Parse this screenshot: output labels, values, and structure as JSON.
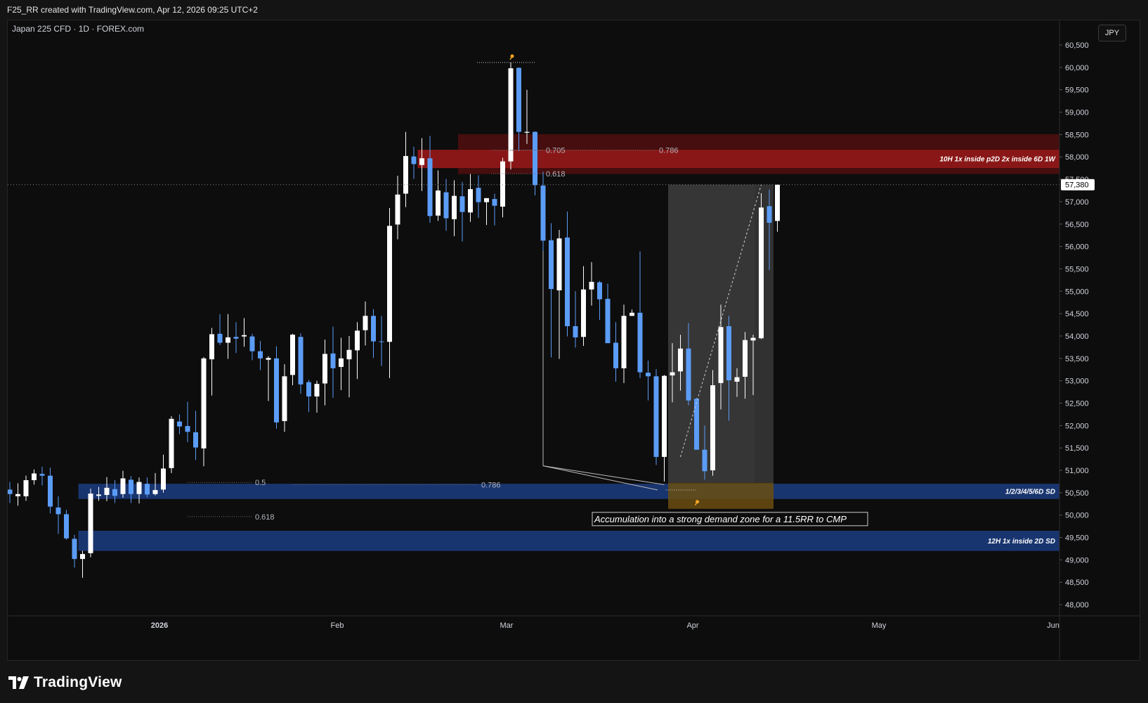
{
  "header": {
    "caption": "F25_RR created with TradingView.com, Apr 12, 2026 09:25 UTC+2"
  },
  "symbol_label": "Japan 225 CFD · 1D · FOREX.com",
  "currency_label": "JPY",
  "footer": {
    "brand": "TradingView",
    "logo_icon": "tradingview-logo-icon"
  },
  "colors": {
    "background": "#0d0d0d",
    "up_candle": "#ffffff",
    "down_candle": "#5b9cf6",
    "supply_zone": "#a11a1a",
    "demand_zone": "#1b3a7a",
    "position_box": "#5a5a5a",
    "stop_box": "#6b4e12",
    "fib_text": "#b2b5be"
  },
  "chart_data": {
    "type": "candlestick",
    "title": "Japan 225 CFD · 1D · FOREX.com",
    "y_range": [
      47750,
      61050
    ],
    "y_ticks": [
      "60,500",
      "60,000",
      "59,500",
      "59,000",
      "58,500",
      "58,000",
      "57,500",
      "57,000",
      "56,500",
      "56,000",
      "55,500",
      "55,000",
      "54,500",
      "54,000",
      "53,500",
      "53,000",
      "52,500",
      "52,000",
      "51,500",
      "51,000",
      "50,500",
      "50,000",
      "49,500",
      "49,000",
      "48,500",
      "48,000"
    ],
    "x_labels": [
      "2026",
      "Feb",
      "Mar",
      "Apr",
      "May",
      "Jun"
    ],
    "current_price": {
      "label": "57,380",
      "value": 57380
    },
    "candles": [
      {
        "o": 50570,
        "h": 50740,
        "l": 50270,
        "c": 50470
      },
      {
        "o": 50420,
        "h": 50710,
        "l": 50210,
        "c": 50470
      },
      {
        "o": 50420,
        "h": 50880,
        "l": 50320,
        "c": 50780
      },
      {
        "o": 50780,
        "h": 51020,
        "l": 50680,
        "c": 50930
      },
      {
        "o": 50920,
        "h": 51080,
        "l": 50660,
        "c": 50880
      },
      {
        "o": 50880,
        "h": 51060,
        "l": 50040,
        "c": 50190
      },
      {
        "o": 50170,
        "h": 50420,
        "l": 49580,
        "c": 50020
      },
      {
        "o": 50020,
        "h": 50120,
        "l": 49450,
        "c": 49480
      },
      {
        "o": 49470,
        "h": 49560,
        "l": 48830,
        "c": 49020
      },
      {
        "o": 49020,
        "h": 49200,
        "l": 48600,
        "c": 49130
      },
      {
        "o": 49150,
        "h": 50590,
        "l": 49060,
        "c": 50480
      },
      {
        "o": 50430,
        "h": 50630,
        "l": 50320,
        "c": 50460
      },
      {
        "o": 50450,
        "h": 50850,
        "l": 50310,
        "c": 50610
      },
      {
        "o": 50580,
        "h": 50780,
        "l": 50270,
        "c": 50430
      },
      {
        "o": 50470,
        "h": 50990,
        "l": 50390,
        "c": 50820
      },
      {
        "o": 50790,
        "h": 50870,
        "l": 50270,
        "c": 50470
      },
      {
        "o": 50470,
        "h": 50840,
        "l": 50260,
        "c": 50740
      },
      {
        "o": 50700,
        "h": 50840,
        "l": 50400,
        "c": 50460
      },
      {
        "o": 50470,
        "h": 50940,
        "l": 50440,
        "c": 50560
      },
      {
        "o": 50570,
        "h": 51350,
        "l": 50500,
        "c": 51040
      },
      {
        "o": 51050,
        "h": 52210,
        "l": 50940,
        "c": 52150
      },
      {
        "o": 52090,
        "h": 52250,
        "l": 51810,
        "c": 51980
      },
      {
        "o": 51990,
        "h": 52530,
        "l": 51630,
        "c": 51860
      },
      {
        "o": 51850,
        "h": 52330,
        "l": 51230,
        "c": 51510
      },
      {
        "o": 51490,
        "h": 53530,
        "l": 51090,
        "c": 53500
      },
      {
        "o": 53480,
        "h": 54180,
        "l": 52670,
        "c": 54040
      },
      {
        "o": 54050,
        "h": 54490,
        "l": 53800,
        "c": 53850
      },
      {
        "o": 53850,
        "h": 54490,
        "l": 53490,
        "c": 53970
      },
      {
        "o": 53980,
        "h": 54310,
        "l": 53620,
        "c": 53940
      },
      {
        "o": 53990,
        "h": 54400,
        "l": 53760,
        "c": 54020
      },
      {
        "o": 53990,
        "h": 54050,
        "l": 53460,
        "c": 53660
      },
      {
        "o": 53660,
        "h": 53890,
        "l": 53240,
        "c": 53500
      },
      {
        "o": 53470,
        "h": 53550,
        "l": 52550,
        "c": 53510
      },
      {
        "o": 53500,
        "h": 53770,
        "l": 51930,
        "c": 52070
      },
      {
        "o": 52100,
        "h": 53370,
        "l": 51860,
        "c": 53100
      },
      {
        "o": 53130,
        "h": 54050,
        "l": 52900,
        "c": 54030
      },
      {
        "o": 53980,
        "h": 54060,
        "l": 52710,
        "c": 52920
      },
      {
        "o": 52970,
        "h": 53020,
        "l": 52300,
        "c": 52650
      },
      {
        "o": 52650,
        "h": 53000,
        "l": 52290,
        "c": 52930
      },
      {
        "o": 52940,
        "h": 53920,
        "l": 52450,
        "c": 53600
      },
      {
        "o": 53610,
        "h": 54210,
        "l": 52620,
        "c": 53280
      },
      {
        "o": 53310,
        "h": 53960,
        "l": 52790,
        "c": 53500
      },
      {
        "o": 53480,
        "h": 54000,
        "l": 52630,
        "c": 53690
      },
      {
        "o": 53680,
        "h": 54310,
        "l": 53040,
        "c": 54120
      },
      {
        "o": 54130,
        "h": 54770,
        "l": 53790,
        "c": 54450
      },
      {
        "o": 54450,
        "h": 54600,
        "l": 53510,
        "c": 53880
      },
      {
        "o": 53880,
        "h": 54450,
        "l": 53330,
        "c": 53870
      },
      {
        "o": 53870,
        "h": 56860,
        "l": 53060,
        "c": 56460
      },
      {
        "o": 56490,
        "h": 57580,
        "l": 56160,
        "c": 57160
      },
      {
        "o": 57180,
        "h": 58560,
        "l": 56880,
        "c": 58020
      },
      {
        "o": 58010,
        "h": 58230,
        "l": 57510,
        "c": 57840
      },
      {
        "o": 57820,
        "h": 58420,
        "l": 57240,
        "c": 57970
      },
      {
        "o": 57970,
        "h": 58470,
        "l": 56530,
        "c": 56680
      },
      {
        "o": 56690,
        "h": 57700,
        "l": 56570,
        "c": 57250
      },
      {
        "o": 57210,
        "h": 57510,
        "l": 56350,
        "c": 56630
      },
      {
        "o": 56610,
        "h": 57480,
        "l": 56230,
        "c": 57130
      },
      {
        "o": 57120,
        "h": 57440,
        "l": 56110,
        "c": 56770
      },
      {
        "o": 56760,
        "h": 57620,
        "l": 56550,
        "c": 57280
      },
      {
        "o": 57310,
        "h": 57590,
        "l": 56640,
        "c": 56990
      },
      {
        "o": 56990,
        "h": 57070,
        "l": 56480,
        "c": 57080
      },
      {
        "o": 57060,
        "h": 57180,
        "l": 56470,
        "c": 56910
      },
      {
        "o": 56890,
        "h": 57980,
        "l": 56650,
        "c": 57900
      },
      {
        "o": 57900,
        "h": 60110,
        "l": 57720,
        "c": 59980
      },
      {
        "o": 59990,
        "h": 60000,
        "l": 58130,
        "c": 58560
      },
      {
        "o": 58540,
        "h": 59500,
        "l": 58290,
        "c": 58560
      },
      {
        "o": 58560,
        "h": 58570,
        "l": 57140,
        "c": 57370
      },
      {
        "o": 57360,
        "h": 57670,
        "l": 54020,
        "c": 56130
      },
      {
        "o": 56140,
        "h": 56520,
        "l": 53520,
        "c": 55050
      },
      {
        "o": 55020,
        "h": 56370,
        "l": 53490,
        "c": 56180
      },
      {
        "o": 56200,
        "h": 56780,
        "l": 53990,
        "c": 54220
      },
      {
        "o": 54220,
        "h": 55000,
        "l": 53740,
        "c": 53970
      },
      {
        "o": 53980,
        "h": 55560,
        "l": 53780,
        "c": 55040
      },
      {
        "o": 55040,
        "h": 55650,
        "l": 54680,
        "c": 55210
      },
      {
        "o": 55200,
        "h": 55230,
        "l": 54360,
        "c": 54820
      },
      {
        "o": 54830,
        "h": 55170,
        "l": 54140,
        "c": 53840
      },
      {
        "o": 53850,
        "h": 54310,
        "l": 52980,
        "c": 53280
      },
      {
        "o": 53280,
        "h": 54700,
        "l": 52950,
        "c": 54450
      },
      {
        "o": 54450,
        "h": 54590,
        "l": 54450,
        "c": 54520
      },
      {
        "o": 54520,
        "h": 55890,
        "l": 53060,
        "c": 53190
      },
      {
        "o": 53180,
        "h": 53450,
        "l": 52560,
        "c": 53100
      },
      {
        "o": 53100,
        "h": 53260,
        "l": 51120,
        "c": 51300
      },
      {
        "o": 51300,
        "h": 53130,
        "l": 50750,
        "c": 53110
      },
      {
        "o": 53120,
        "h": 53840,
        "l": 52520,
        "c": 53190
      },
      {
        "o": 53210,
        "h": 54030,
        "l": 52780,
        "c": 53720
      },
      {
        "o": 53720,
        "h": 54290,
        "l": 52450,
        "c": 52560
      },
      {
        "o": 52600,
        "h": 52620,
        "l": 51800,
        "c": 51460
      },
      {
        "o": 51460,
        "h": 52000,
        "l": 50790,
        "c": 50980
      },
      {
        "o": 51000,
        "h": 53240,
        "l": 50880,
        "c": 52900
      },
      {
        "o": 52950,
        "h": 54700,
        "l": 52360,
        "c": 54200
      },
      {
        "o": 54220,
        "h": 54450,
        "l": 52110,
        "c": 53010
      },
      {
        "o": 52980,
        "h": 53280,
        "l": 52640,
        "c": 53080
      },
      {
        "o": 53090,
        "h": 54090,
        "l": 52600,
        "c": 53910
      },
      {
        "o": 53900,
        "h": 54030,
        "l": 52680,
        "c": 53960
      },
      {
        "o": 53950,
        "h": 57190,
        "l": 53930,
        "c": 56870
      },
      {
        "o": 56900,
        "h": 57270,
        "l": 55470,
        "c": 56530
      },
      {
        "o": 56570,
        "h": 57380,
        "l": 56330,
        "c": 57380
      }
    ],
    "zones": [
      {
        "label": "10H 1x inside p2D 2x inside 6D 1W",
        "kind": "supply",
        "from": 57750,
        "to": 58160
      },
      {
        "label": "1/2/3/4/5/6D SD",
        "kind": "demand",
        "from": 50360,
        "to": 50700
      },
      {
        "label": "12H 1x inside 2D SD",
        "kind": "demand",
        "from": 49200,
        "to": 49650
      }
    ],
    "fib_levels": [
      {
        "label": "0.705",
        "value": 58150
      },
      {
        "label": "0.786",
        "value": 58150
      },
      {
        "label": "0.618",
        "value": 57580
      },
      {
        "label": "0.5",
        "value": 50730
      },
      {
        "label": "0.786",
        "value": 50680
      },
      {
        "label": "0.618",
        "value": 50250
      }
    ],
    "long_position": {
      "entry": 50720,
      "target": 57380,
      "stop": 50140
    },
    "annotation": "Accumulation into a strong demand zone for a 11.5RR to CMP"
  }
}
